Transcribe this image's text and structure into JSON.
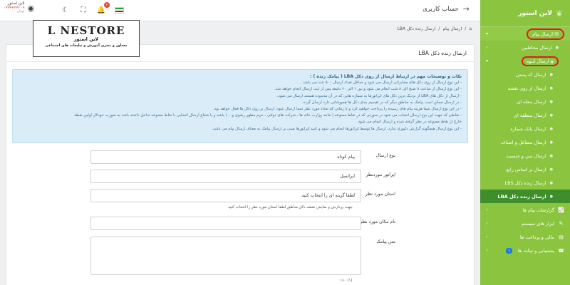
{
  "app": {
    "brand_name": "لاین استور",
    "page_title": "حساب کاربری",
    "user_name": "لاین استور",
    "user_phone": "۰۹۹۹۹۹۹۹۰۰۹",
    "user_balance": "تومان",
    "notification_count": "۴"
  },
  "logo": {
    "main": "L NESTORE",
    "fa": "لاین استور",
    "sub": "مشاور و مجری آموزش و تبلیغات های اجتماعی"
  },
  "sidebar": {
    "items": [
      {
        "label": "ارسال پیام",
        "icon": "envelope-icon",
        "level": 0
      },
      {
        "label": "ارسال مخاطبین",
        "icon": "bullet",
        "level": 1
      },
      {
        "label": "ارسال انبوه",
        "icon": "bullet",
        "level": 1
      },
      {
        "label": "ارسال کد پستی",
        "icon": "bullet",
        "level": 2
      },
      {
        "label": "ارسال از روی نقشه",
        "icon": "bullet",
        "level": 2
      },
      {
        "label": "ارسال محله ای",
        "icon": "bullet",
        "level": 2
      },
      {
        "label": "ارسال منطقه ای",
        "icon": "bullet",
        "level": 2
      },
      {
        "label": "ارسال بانک شماره",
        "icon": "bullet",
        "level": 2
      },
      {
        "label": "ارسال مشاغل و اصناف",
        "icon": "bullet",
        "level": 2
      },
      {
        "label": "ارسال سن و جنسیت",
        "icon": "bullet",
        "level": 2
      },
      {
        "label": "ارسال بر اساس رابع",
        "icon": "bullet",
        "level": 2
      },
      {
        "label": "ارسال زنده دکل LBS",
        "icon": "bullet",
        "level": 2
      },
      {
        "label": "ارسال زنده دکل LBA",
        "icon": "bullet",
        "level": 2,
        "active": true
      },
      {
        "label": "گزارشات پیام ها",
        "icon": "chart-icon",
        "level": 0
      },
      {
        "label": "ابزار های سیستم",
        "icon": "tools-icon",
        "level": 0
      },
      {
        "label": "مالی و پرداخت ها",
        "icon": "wallet-icon",
        "level": 0
      },
      {
        "label": "پشتیبانی و تیکت ها",
        "icon": "support-icon",
        "level": 0,
        "badge": "۱"
      }
    ]
  },
  "breadcrumb": {
    "home": "⌂",
    "sep": "/",
    "level1": "ارسال پیام",
    "level2": "ارسال زنده دکل LBA"
  },
  "card": {
    "title": "ارسال زنده دکل LBA"
  },
  "notice": {
    "title": "نکات و توضیحات مهم در ارتباط ارسال از روی دکل LBA ( پیامک زنده ) :",
    "lines": [
      "- این نوع ارسال از روی دکل های مخابراتی ارسال می شود و حداقل تعداد ارسال ۵۰۰ عدد می باشد .",
      "- این نوع ارسال از ساعت ۸ صبح الی ۸ شب انجام می شود و بین ۱ الی ۶۰ دقیقه پس از ثبت ارسال انجام خواهد شد.",
      "- ارسال از دکل های LBA از نزدیک ترین دکل های اپراتورها به شماره هایی که در آن محدوده هستند ارسال می شود.",
      "- در ارسال ممکن است پیامک به مناطق دیگر که در تقسیم بندی دکل ها همپوشانی دارد ارسال گردد.",
      "- در این نوع ارسال شما هزینه پیام های رسیده را پرداخت خواهید کرد و تا زمانی که تعداد مورد نظر شما ارسال شود، ارسال بر روی دکل ها فعال خواهد بود.",
      "- نقاطی که جهت این نوع ارسال انتخاب می شود در صورتی که در نقاط ممنوعه ( مانند وزارت خانه ها ، شرکت های دولتی ، حرم مطهر رضوی و... ) باشد و یا شعاع ارسال انتخابی با نقاط ممنوعه تداخل داشته باشد به صورت خودکار اولین نقطه",
      "خارج از نقاط ممنوعه در نظر گرفته شده و ارسال انجام می شود.",
      "- این نوع ارسال هیچگونه گزارش دلیوری ندارد. ارسال ها توسط اپراتورها انجام می شود و تایید اپراتورها مبنی بر ارسال پیامک به معنای ارسال پیام می باشد."
    ]
  },
  "form": {
    "type_label": "نوع ارسال",
    "type_value": "پیام کوتاه",
    "operator_label": "اپراتور موردنظر",
    "operator_value": "ایرانسل",
    "province_label": "استان مورد نظر",
    "province_value": "لطفا گزینه ای را انتخاب کنید",
    "province_hint": "جهت پردازش و نمایش نقشه دکل مناطق لطفا استان مورد نظر را انتخاب کنید",
    "place_label": "نام مکان مورد نظر",
    "sms_label": "متن پیامک",
    "counter": "۱۶۰ (۱)"
  },
  "colors": {
    "sidebar_bg": "#8bc53f",
    "active_bg": "#3f8e2c",
    "notice_bg": "#d9ecf8",
    "highlight_circle": "#e01b24"
  }
}
